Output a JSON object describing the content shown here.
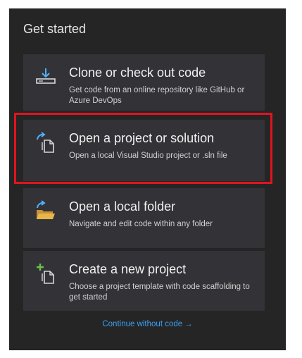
{
  "header": {
    "title": "Get started"
  },
  "cards": [
    {
      "title": "Clone or check out code",
      "description": "Get code from an online repository like GitHub or Azure DevOps",
      "icon": "clone-download-icon"
    },
    {
      "title": "Open a project or solution",
      "description": "Open a local Visual Studio project or .sln file",
      "icon": "open-project-icon"
    },
    {
      "title": "Open a local folder",
      "description": "Navigate and edit code within any folder",
      "icon": "open-folder-icon"
    },
    {
      "title": "Create a new project",
      "description": "Choose a project template with code scaffolding to get started",
      "icon": "new-project-icon"
    }
  ],
  "footer": {
    "continue_label": "Continue without code",
    "continue_arrow": "→"
  },
  "colors": {
    "panel_background": "#252526",
    "card_background": "#333337",
    "highlight_border": "#e0141e",
    "link": "#3ea0f0",
    "icon_blue": "#4fb0ff",
    "folder_yellow": "#e8b54a",
    "plus_green": "#6cc04a"
  }
}
